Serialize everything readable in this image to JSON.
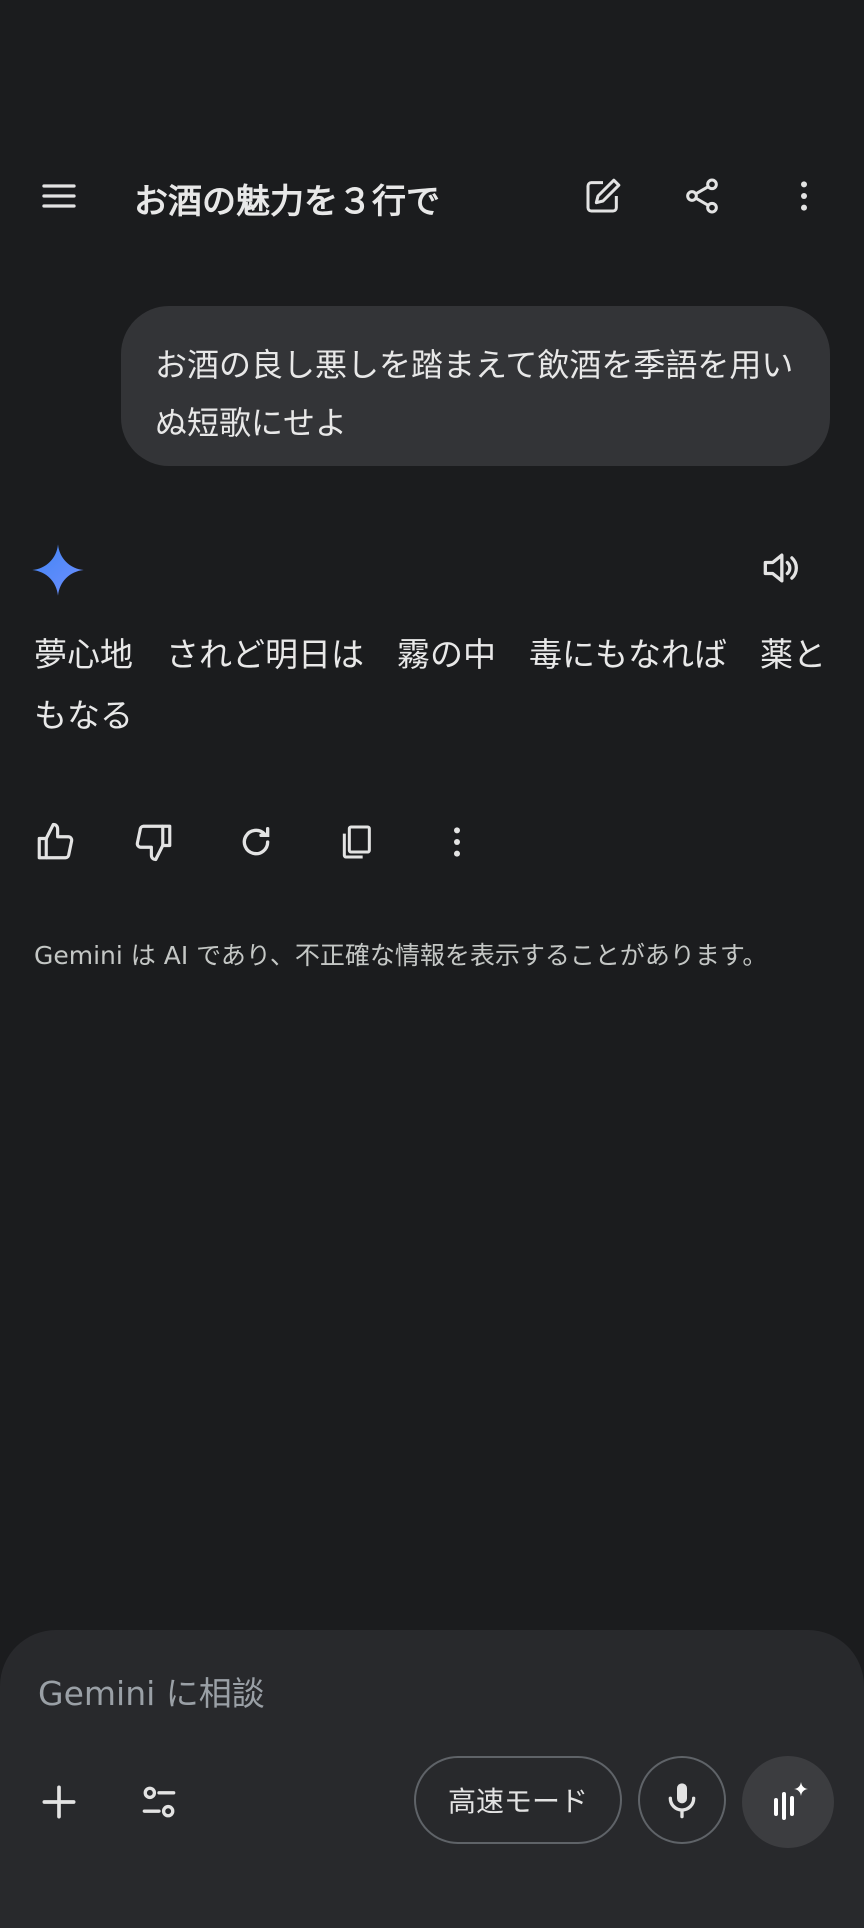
{
  "header": {
    "title": "お酒の魅力を３行で",
    "icons": [
      "menu-icon",
      "edit-icon",
      "share-icon",
      "more-vert-icon"
    ]
  },
  "conversation": {
    "user_message": "お酒の良し悪しを踏まえて飲酒を季語を用いぬ短歌にせよ",
    "model_response": "夢心地　されど明日は　霧の中　毒にもなれば　薬ともなる",
    "response_icons": [
      "gemini-sparkle-icon",
      "speaker-icon"
    ],
    "actions": [
      "thumbs-up-icon",
      "thumbs-down-icon",
      "regenerate-icon",
      "copy-icon",
      "more-vert-icon"
    ]
  },
  "disclaimer": "Gemini は AI であり、不正確な情報を表示することがあります。",
  "composer": {
    "placeholder": "Gemini に相談",
    "mode_label": "高速モード",
    "icons": [
      "plus-icon",
      "tools-icon",
      "mic-icon",
      "live-icon"
    ]
  },
  "colors": {
    "background": "#1b1c1e",
    "user_bubble": "#333437",
    "composer": "#28292c",
    "text": "#e3e3e3",
    "gemini_blue": "#4285f4"
  }
}
